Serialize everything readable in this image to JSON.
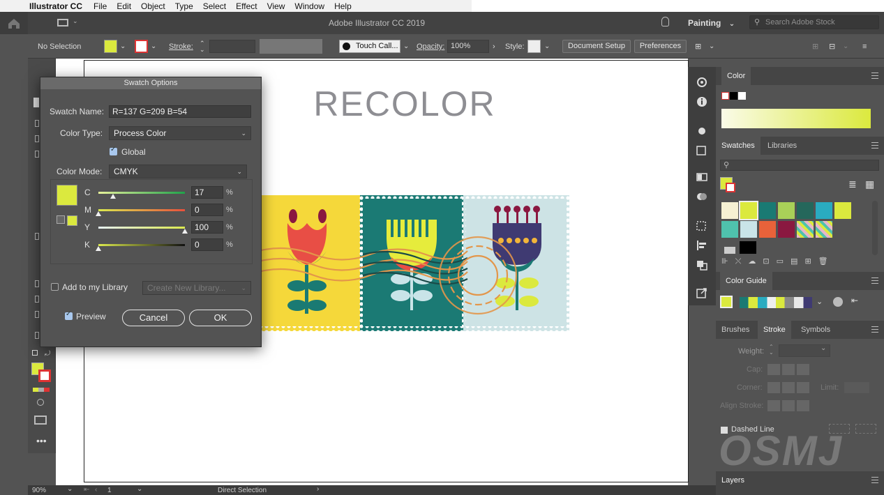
{
  "menubar": {
    "app": "Illustrator CC",
    "items": [
      "File",
      "Edit",
      "Object",
      "Type",
      "Select",
      "Effect",
      "View",
      "Window",
      "Help"
    ]
  },
  "titlebar": {
    "title": "Adobe Illustrator CC 2019",
    "workspace": "Painting",
    "search_placeholder": "Search Adobe Stock"
  },
  "controlbar": {
    "selection": "No Selection",
    "stroke_label": "Stroke:",
    "brush": "Touch Call...",
    "opacity_label": "Opacity:",
    "opacity_value": "100%",
    "style_label": "Style:",
    "document_setup": "Document Setup",
    "preferences": "Preferences"
  },
  "canvas": {
    "heading": "RECOLOR"
  },
  "dialog": {
    "title": "Swatch Options",
    "swatch_name_label": "Swatch Name:",
    "swatch_name_value": "R=137 G=209 B=54",
    "color_type_label": "Color Type:",
    "color_type_value": "Process Color",
    "global_label": "Global",
    "global_checked": true,
    "color_mode_label": "Color Mode:",
    "color_mode_value": "CMYK",
    "channels": [
      {
        "label": "C",
        "value": "17",
        "level": 0.17,
        "track": "linear-gradient(90deg,#e6f29a,#1fa24a)"
      },
      {
        "label": "M",
        "value": "0",
        "level": 0.0,
        "track": "linear-gradient(90deg,#dbe94e,#e8503c)"
      },
      {
        "label": "Y",
        "value": "100",
        "level": 1.0,
        "track": "linear-gradient(90deg,#e6f0f2,#dbe94e)"
      },
      {
        "label": "K",
        "value": "0",
        "level": 0.0,
        "track": "linear-gradient(90deg,#dbe94e,#111111)"
      }
    ],
    "percent": "%",
    "add_library_label": "Add to my Library",
    "create_library": "Create New Library...",
    "preview_label": "Preview",
    "cancel": "Cancel",
    "ok": "OK",
    "swatch_color": "#dbe93e"
  },
  "panels": {
    "color_tab": "Color",
    "swatches_tab": "Swatches",
    "libraries_tab": "Libraries",
    "color_guide_tab": "Color Guide",
    "brushes_tab": "Brushes",
    "stroke_tab": "Stroke",
    "symbols_tab": "Symbols",
    "weight_label": "Weight:",
    "cap_label": "Cap:",
    "corner_label": "Corner:",
    "limit_label": "Limit:",
    "align_label": "Align Stroke:",
    "dashed_label": "Dashed Line",
    "layers_tab": "Layers",
    "swatches_row1": [
      "#f6f1d3",
      "#dbe93e",
      "#1a7a73",
      "#a9d058",
      "#25675b",
      "#2aabc0",
      "#dbe93e"
    ],
    "swatches_row2": [
      "#4fc2ad",
      "#c9e4e8",
      "#e8623a",
      "#8a1840",
      "#pattern",
      "#pattern"
    ]
  },
  "statusbar": {
    "zoom": "90%",
    "page": "1",
    "tool": "Direct Selection"
  },
  "watermark": "OSMJ"
}
